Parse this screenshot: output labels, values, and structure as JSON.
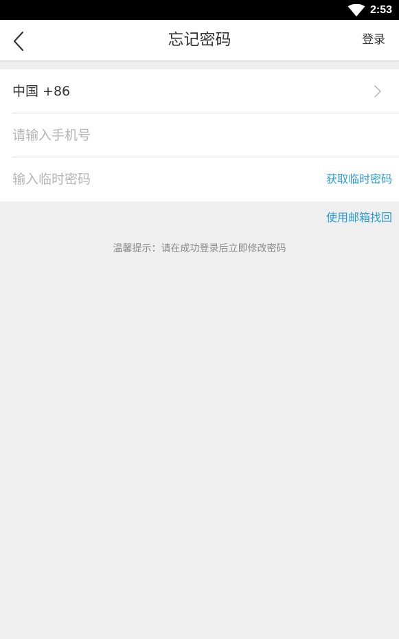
{
  "status_bar": {
    "time": "2:53",
    "wifi_icon": "wifi-icon"
  },
  "header": {
    "back_icon": "chevron-left-icon",
    "title": "忘记密码",
    "login_label": "登录"
  },
  "form": {
    "country": {
      "label": "中国 +86",
      "chevron_icon": "chevron-right-icon"
    },
    "phone": {
      "value": "",
      "placeholder": "请输入手机号"
    },
    "temp_password": {
      "value": "",
      "placeholder": "输入临时密码",
      "get_code_label": "获取临时密码"
    }
  },
  "email_recovery_label": "使用邮箱找回",
  "hint_text": "温馨提示：请在成功登录后立即修改密码",
  "colors": {
    "accent": "#2e9bd6",
    "background": "#efefef",
    "text": "#333333",
    "placeholder": "#b5b5b5"
  }
}
